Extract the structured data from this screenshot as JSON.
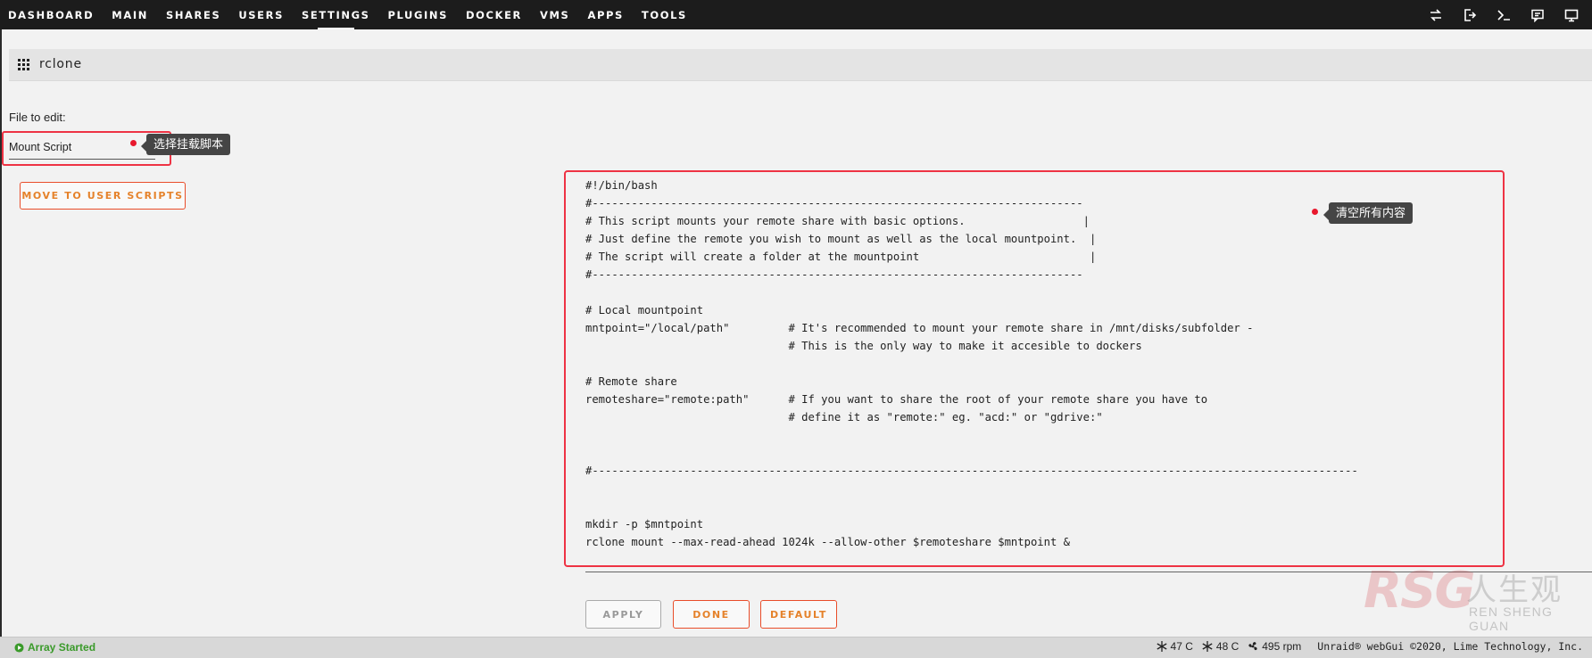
{
  "nav": {
    "items": [
      "DASHBOARD",
      "MAIN",
      "SHARES",
      "USERS",
      "SETTINGS",
      "PLUGINS",
      "DOCKER",
      "VMS",
      "APPS",
      "TOOLS"
    ],
    "active": "SETTINGS",
    "icons": [
      "swap-icon",
      "logout-icon",
      "terminal-icon",
      "feedback-icon",
      "monitor-icon"
    ]
  },
  "section": {
    "title": "rclone",
    "icon": "grid-icon"
  },
  "file_select": {
    "label": "File to edit:",
    "value": "Mount Script"
  },
  "annotations": {
    "select_tip": "选择挂载脚本",
    "clear_tip": "清空所有内容",
    "color": "#ee3344"
  },
  "buttons": {
    "move": "MOVE TO USER SCRIPTS",
    "apply": "APPLY",
    "done": "DONE",
    "default": "DEFAULT"
  },
  "editor": {
    "lines": [
      "#!/bin/bash",
      "#---------------------------------------------------------------------------",
      "# This script mounts your remote share with basic options.                  |",
      "# Just define the remote you wish to mount as well as the local mountpoint.  |",
      "# The script will create a folder at the mountpoint                          |",
      "#---------------------------------------------------------------------------",
      "",
      "# Local mountpoint",
      "mntpoint=\"/local/path\"         # It's recommended to mount your remote share in /mnt/disks/subfolder -",
      "                               # This is the only way to make it accesible to dockers",
      "",
      "# Remote share",
      "remoteshare=\"remote:path\"      # If you want to share the root of your remote share you have to",
      "                               # define it as \"remote:\" eg. \"acd:\" or \"gdrive:\"",
      "",
      "",
      "#---------------------------------------------------------------------------------------------------------------------",
      "",
      "",
      "mkdir -p $mntpoint",
      "rclone mount --max-read-ahead 1024k --allow-other $remoteshare $mntpoint &"
    ]
  },
  "footer": {
    "status": "Array Started",
    "temps": [
      "47 C",
      "48 C"
    ],
    "fan": "495 rpm",
    "copyright": "Unraid® webGui ©2020, Lime Technology, Inc.",
    "status_color": "#3a9a2a"
  },
  "watermark": {
    "logo": "RSG",
    "cn": "人生观",
    "en": "REN SHENG GUAN"
  }
}
